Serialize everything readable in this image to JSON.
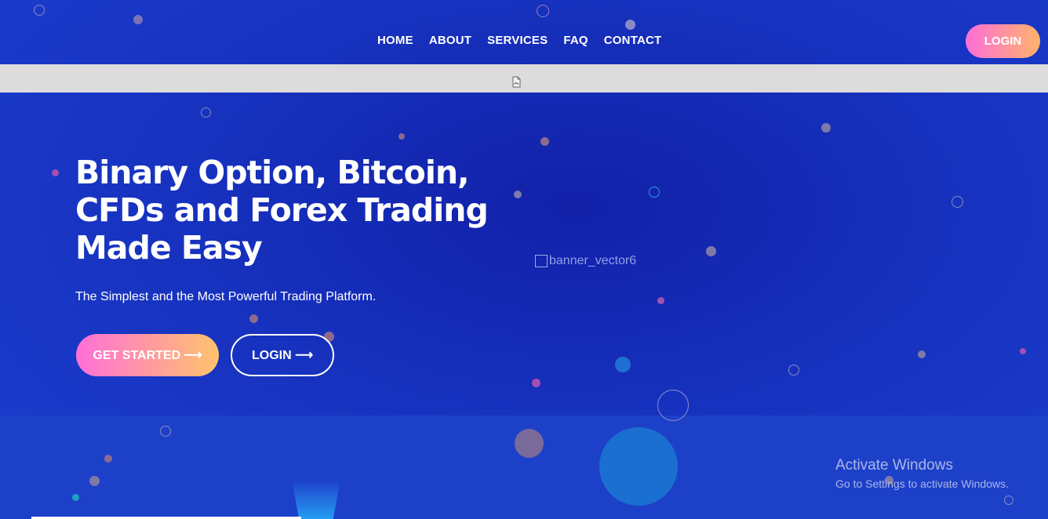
{
  "nav": {
    "items": [
      "HOME",
      "ABOUT",
      "SERVICES",
      "FAQ",
      "CONTACT"
    ],
    "login_label": "LOGIN"
  },
  "hero": {
    "title_lines": [
      "Binary Option, Bitcoin,",
      "CFDs and Forex Trading",
      "Made Easy"
    ],
    "subtitle": "The Simplest and the Most Powerful Trading Platform.",
    "get_started_label": "GET STARTED ⟶",
    "login_label": "LOGIN ⟶",
    "banner_alt": "banner_vector6"
  },
  "watermark": {
    "line1": "Activate Windows",
    "line2": "Go to Settings to activate Windows."
  },
  "colors": {
    "background": "#1a2fc4",
    "accent_gradient_start": "#ff6fd8",
    "accent_gradient_end": "#ffb36b",
    "strip": "#dcdcdc"
  },
  "icons": [
    "broken-image-icon"
  ]
}
